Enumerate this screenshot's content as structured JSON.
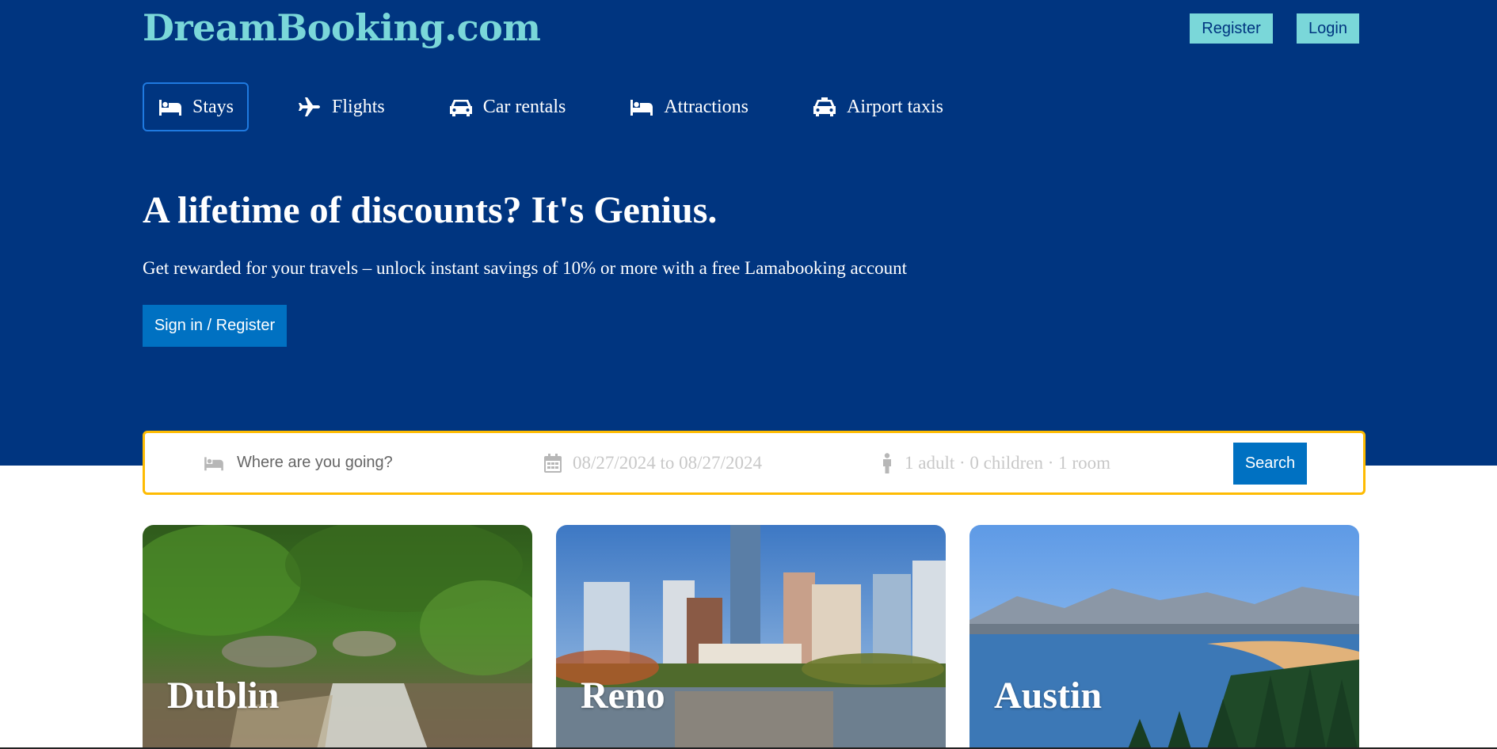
{
  "brand": {
    "logo_text": "DreamBooking.com"
  },
  "header_buttons": {
    "register_label": "Register",
    "login_label": "Login"
  },
  "nav": {
    "items": [
      {
        "label": "Stays",
        "icon": "bed-icon",
        "active": true
      },
      {
        "label": "Flights",
        "icon": "plane-icon",
        "active": false
      },
      {
        "label": "Car rentals",
        "icon": "car-icon",
        "active": false
      },
      {
        "label": "Attractions",
        "icon": "bed-icon",
        "active": false
      },
      {
        "label": "Airport taxis",
        "icon": "taxi-icon",
        "active": false
      }
    ]
  },
  "hero": {
    "title": "A lifetime of discounts? It's Genius.",
    "subtitle": "Get rewarded for your travels – unlock instant savings of 10% or more with a free Lamabooking account",
    "cta_label": "Sign in / Register"
  },
  "search": {
    "destination_placeholder": "Where are you going?",
    "dates_text": "08/27/2024 to 08/27/2024",
    "guests_text": "1 adult · 0 children · 1 room",
    "button_label": "Search"
  },
  "cards": [
    {
      "title": "Dublin"
    },
    {
      "title": "Reno"
    },
    {
      "title": "Austin"
    }
  ],
  "colors": {
    "header_bg": "#003580",
    "logo": "#7ad7d9",
    "primary_button": "#0071c2",
    "search_border": "#febb02"
  }
}
